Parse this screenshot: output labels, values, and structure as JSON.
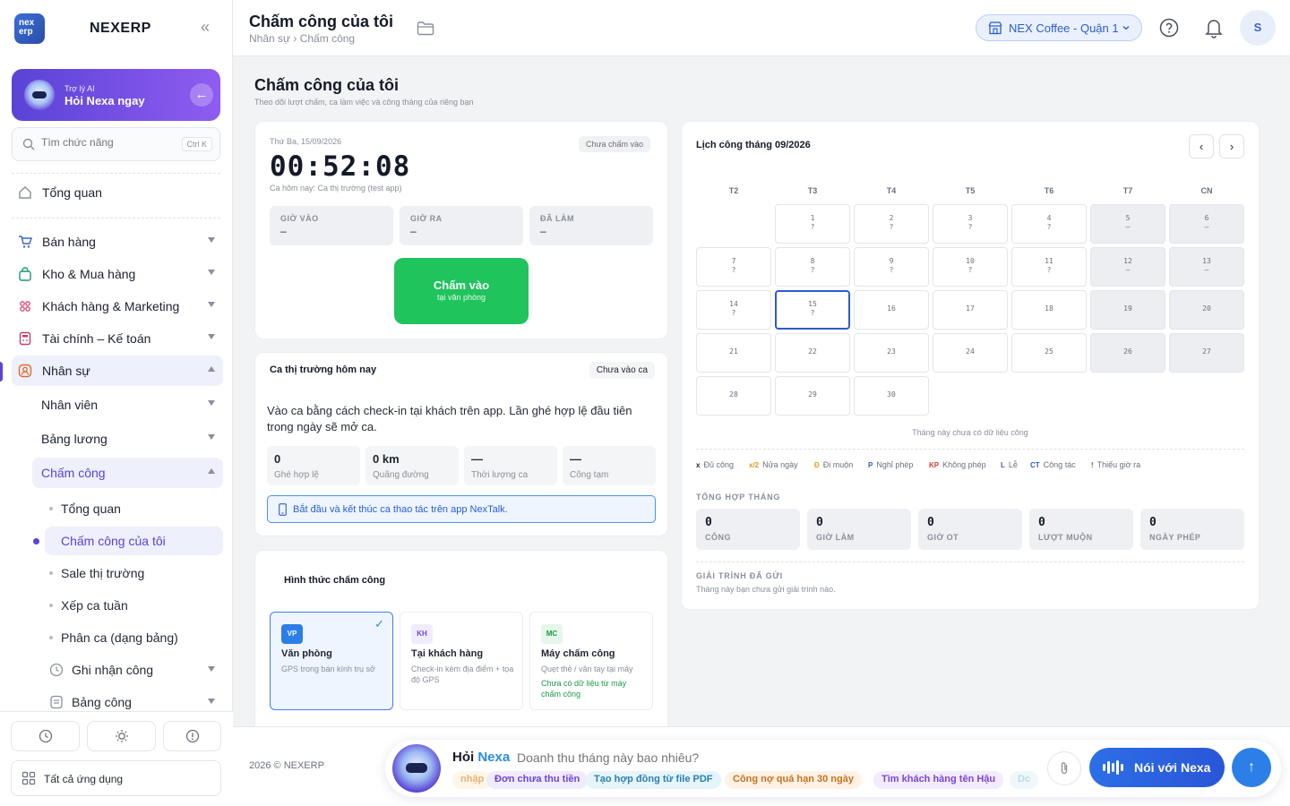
{
  "sidebar": {
    "logo_text": "nex erp",
    "brand": "NEXERP",
    "collapse": "«",
    "ai": {
      "label": "Trợ lý AI",
      "title": "Hỏi Nexa ngay"
    },
    "search": {
      "placeholder": "Tìm chức năng",
      "shortcut": "Ctrl K"
    },
    "items": [
      {
        "label": "Tổng quan",
        "icon": "home-icon"
      },
      {
        "label": "Bán hàng",
        "icon": "cart-icon"
      },
      {
        "label": "Kho & Mua hàng",
        "icon": "bag-icon"
      },
      {
        "label": "Khách hàng & Marketing",
        "icon": "people-icon"
      },
      {
        "label": "Tài chính – Kế toán",
        "icon": "calculator-icon"
      },
      {
        "label": "Nhân sự",
        "icon": "user-icon"
      }
    ],
    "hr_sub": {
      "employees": "Nhân viên",
      "payroll": "Bảng lương",
      "attendance": "Chấm công",
      "leaves": [
        "Tổng quan",
        "Chấm công của tôi",
        "Sale thị trường",
        "Xếp ca tuần",
        "Phân ca (dạng bảng)"
      ],
      "record": "Ghi nhận công",
      "timesheet": "Bảng công"
    },
    "all_apps": "Tất cả ứng dụng"
  },
  "topbar": {
    "title": "Chấm công của tôi",
    "breadcrumb": "Nhân sự › Chấm công",
    "store": "NEX Coffee - Quận 1",
    "avatar": "S"
  },
  "page": {
    "title": "Chấm công của tôi",
    "subtitle": "Theo dõi lượt chấm, ca làm việc và công tháng của riêng bạn"
  },
  "clock_card": {
    "date": "Thứ Ba, 15/09/2026",
    "status": "Chưa chấm vào",
    "time": "00:52:08",
    "shift": "Ca hôm nay: Ca thị trường (test app)",
    "stats": [
      {
        "label": "GIỜ VÀO",
        "value": "–"
      },
      {
        "label": "GIỜ RA",
        "value": "–"
      },
      {
        "label": "ĐÃ LÀM",
        "value": "–"
      }
    ],
    "button": {
      "title": "Chấm vào",
      "sub": "tại văn phòng"
    }
  },
  "market_card": {
    "title": "Ca thị trường hôm nay",
    "badge": "Chưa vào ca",
    "desc": "Vào ca bằng cách check-in tại khách trên app. Lần ghé hợp lệ đầu tiên trong ngày sẽ mở ca.",
    "stats": [
      {
        "value": "0",
        "label": "Ghé hợp lệ"
      },
      {
        "value": "0 km",
        "label": "Quãng đường"
      },
      {
        "value": "—",
        "label": "Thời lượng ca"
      },
      {
        "value": "—",
        "label": "Công tạm"
      }
    ],
    "info": "Bắt đầu và kết thúc ca thao tác trên app NexTalk."
  },
  "method_card": {
    "title": "Hình thức chấm công",
    "methods": [
      {
        "tag": "VP",
        "name": "Văn phòng",
        "desc": "GPS trong bán kính trụ sở",
        "warn": ""
      },
      {
        "tag": "KH",
        "name": "Tại khách hàng",
        "desc": "Check-in kèm địa điểm + tọa độ GPS",
        "warn": ""
      },
      {
        "tag": "MC",
        "name": "Máy chấm công",
        "desc": "Quẹt thẻ / vân tay tại máy",
        "warn": "Chưa có dữ liệu từ máy chấm công"
      }
    ],
    "selected": 0
  },
  "calendar": {
    "title": "Lịch công tháng 09/2026",
    "prev": "‹",
    "next": "›",
    "dow": [
      "T2",
      "T3",
      "T4",
      "T5",
      "T6",
      "T7",
      "CN"
    ],
    "days": [
      {
        "d": "1",
        "s": "?"
      },
      {
        "d": "2",
        "s": "?"
      },
      {
        "d": "3",
        "s": "?"
      },
      {
        "d": "4",
        "s": "?"
      },
      {
        "d": "5",
        "s": "–"
      },
      {
        "d": "6",
        "s": "–"
      },
      {
        "d": "7",
        "s": "?"
      },
      {
        "d": "8",
        "s": "?"
      },
      {
        "d": "9",
        "s": "?"
      },
      {
        "d": "10",
        "s": "?"
      },
      {
        "d": "11",
        "s": "?"
      },
      {
        "d": "12",
        "s": "–"
      },
      {
        "d": "13",
        "s": "–"
      },
      {
        "d": "14",
        "s": "?"
      },
      {
        "d": "15",
        "s": "?"
      },
      {
        "d": "16",
        "s": ""
      },
      {
        "d": "17",
        "s": ""
      },
      {
        "d": "18",
        "s": ""
      },
      {
        "d": "19",
        "s": ""
      },
      {
        "d": "20",
        "s": ""
      },
      {
        "d": "21",
        "s": ""
      },
      {
        "d": "22",
        "s": ""
      },
      {
        "d": "23",
        "s": ""
      },
      {
        "d": "24",
        "s": ""
      },
      {
        "d": "25",
        "s": ""
      },
      {
        "d": "26",
        "s": ""
      },
      {
        "d": "27",
        "s": ""
      },
      {
        "d": "28",
        "s": ""
      },
      {
        "d": "29",
        "s": ""
      },
      {
        "d": "30",
        "s": ""
      }
    ],
    "first_weekday_index": 1,
    "today": "15",
    "no_data": "Tháng này chưa có dữ liệu công",
    "legend": [
      {
        "code": "x",
        "label": "Đủ công",
        "color": "#1f2430"
      },
      {
        "code": "x/2",
        "label": "Nửa ngày",
        "color": "#d89a1a"
      },
      {
        "code": "Đ",
        "label": "Đi muộn",
        "color": "#e0a21c"
      },
      {
        "code": "P",
        "label": "Nghỉ phép",
        "color": "#2c5cc9"
      },
      {
        "code": "KP",
        "label": "Không phép",
        "color": "#d93838"
      },
      {
        "code": "L",
        "label": "Lễ",
        "color": "#5a43d6"
      },
      {
        "code": "CT",
        "label": "Công tác",
        "color": "#2c5cc9"
      },
      {
        "code": "!",
        "label": "Thiếu giờ ra",
        "color": "#d93838"
      }
    ],
    "summary_title": "TỔNG HỢP THÁNG",
    "summary": [
      {
        "value": "0",
        "label": "CÔNG"
      },
      {
        "value": "0",
        "label": "GIỜ LÀM"
      },
      {
        "value": "0",
        "label": "GIỜ OT"
      },
      {
        "value": "0",
        "label": "LƯỢT MUỘN"
      },
      {
        "value": "0",
        "label": "NGÀY PHÉP"
      }
    ],
    "explain_title": "GIẢI TRÌNH ĐÃ GỬI",
    "explain_text": "Tháng này bạn chưa gửi giải trình nào."
  },
  "footer": {
    "copyright": "2026 © NEXERP",
    "ask_prefix": "Hỏi",
    "ask_brand": "Nexa",
    "ask_placeholder": "Doanh thu tháng này bao nhiêu?",
    "chips": [
      {
        "label": "nhập",
        "bg": "#fff6e8",
        "color": "#e2b574"
      },
      {
        "label": "Đơn chưa thu tiền",
        "bg": "#f0ebff",
        "color": "#6a45d6"
      },
      {
        "label": "Tạo hợp đồng từ file PDF",
        "bg": "#e6f4fb",
        "color": "#2a7fb0"
      },
      {
        "label": "Công nợ quá hạn 30 ngày",
        "bg": "#fff1e4",
        "color": "#c7711d"
      },
      {
        "label": "Tìm khách hàng tên Hậu",
        "bg": "#f3ebff",
        "color": "#7a45d6"
      },
      {
        "label": "Dc",
        "bg": "#eef8fb",
        "color": "#b8dbe6"
      }
    ],
    "voice": "Nói với Nexa",
    "send": "↑"
  }
}
